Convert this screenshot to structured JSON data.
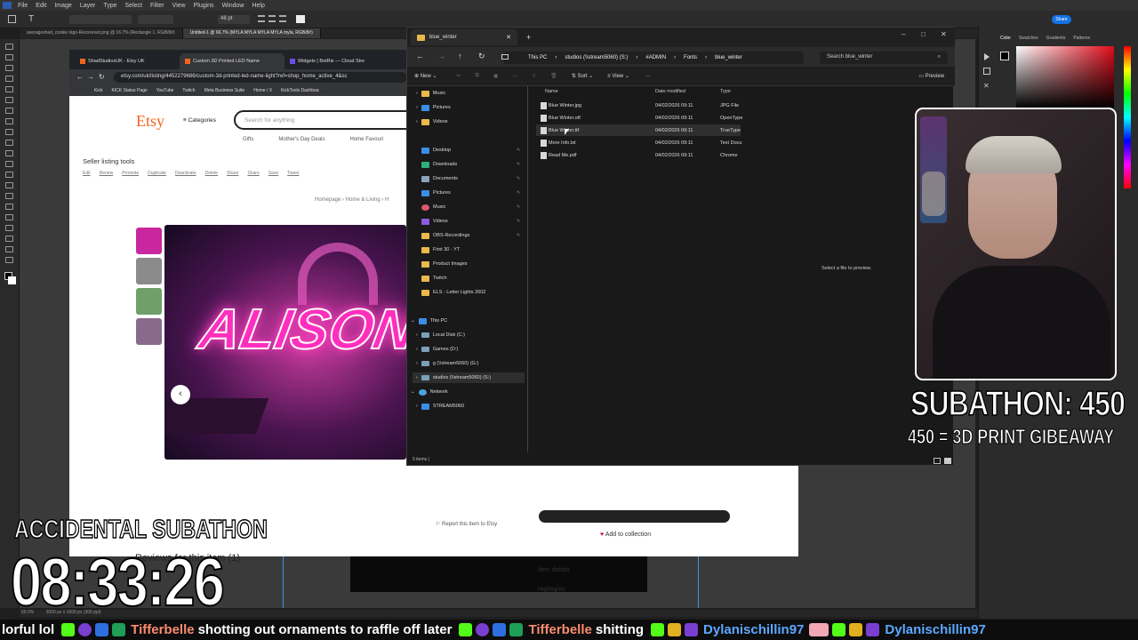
{
  "ps": {
    "menu": [
      "File",
      "Edit",
      "Image",
      "Layer",
      "Type",
      "Select",
      "Filter",
      "View",
      "Plugins",
      "Window",
      "Help"
    ],
    "doc_tabs": [
      "averageshad_cookie logo-Recovered.png @ 16.7% (Rectangle 1, RGB/8#)",
      "Untitled-1 @ 66.7% (MYLA MYLA MYLA MYLA myla, RGB/8#)"
    ],
    "font_size": "48 pt",
    "share_label": "Share",
    "right_tabs": [
      "Color",
      "Swatches",
      "Gradients",
      "Patterns"
    ],
    "status": "60.0%",
    "status2": "3000 px x 1600 px (300 ppi)"
  },
  "browser": {
    "tabs": [
      "ShadStudiosUK - Etsy UK",
      "Custom 3D Printed LED Name",
      "Widgets | BotRix — Cloud Stre"
    ],
    "url": "etsy.com/uk/listing/4452279686/custom-3d-printed-led-name-light?ref=shop_home_active_4&sc",
    "bookmarks": [
      "Kick",
      "KICK Status Page",
      "YouTube",
      "Twitch",
      "Meta Business Suite",
      "Home / X",
      "KickTools Dashboa"
    ]
  },
  "etsy": {
    "logo": "Etsy",
    "categories": "Categories",
    "search_placeholder": "Search for anything",
    "nav": [
      "Gifts",
      "Mother's Day Deals",
      "Home Favouri"
    ],
    "tools_title": "Seller listing tools",
    "tools_links": [
      "Edit",
      "Renew",
      "Promote",
      "Duplicate",
      "Deactivate",
      "Delete",
      "Share",
      "Share",
      "Save",
      "Tweet"
    ],
    "breadcrumb": "Homepage  ›  Home & Living  ›  H",
    "hero_text": "ALISON",
    "report": "Report this item to Etsy",
    "add_collection": "Add to collection",
    "reviews_title": "Reviews for this item (1)",
    "item_details": "Item details",
    "highlights": "Highlights"
  },
  "explorer": {
    "tab_title": "blue_winter",
    "breadcrumb": [
      "This PC",
      "studios (\\\\stream5060) (S:)",
      "#ADMIN",
      "Fonts",
      "blue_winter"
    ],
    "search_placeholder": "Search blue_winter",
    "cmd": {
      "new": "New",
      "sort": "Sort",
      "view": "View",
      "more": "···",
      "preview": "Preview"
    },
    "sidebar_top": [
      "Music",
      "Pictures",
      "Videos"
    ],
    "quick_access": [
      "Desktop",
      "Downloads",
      "Documents",
      "Pictures",
      "Music",
      "Videos",
      "OBS-Recordings",
      "First 30 - YT",
      "Product Images",
      "Twitch",
      "ELS - Letter Lights 2602"
    ],
    "this_pc": "This PC",
    "drives": [
      "Local Disk (C:)",
      "Games (D:)",
      "g (\\\\stream5060) (G:)",
      "studios (\\\\stream5060) (S:)"
    ],
    "network": "Network",
    "network_items": [
      "STREAM5060"
    ],
    "columns": {
      "name": "Name",
      "date": "Date modified",
      "type": "Type"
    },
    "files": [
      {
        "name": "Blue Winter.jpg",
        "date": "04/02/2026 09:11",
        "type": "JPG File"
      },
      {
        "name": "Blue Winter.otf",
        "date": "04/02/2026 09:11",
        "type": "OpenType"
      },
      {
        "name": "Blue Winter.ttf",
        "date": "04/02/2026 09:11",
        "type": "TrueType"
      },
      {
        "name": "More Info.txt",
        "date": "04/02/2026 09:11",
        "type": "Text Docu"
      },
      {
        "name": "Read Me.pdf",
        "date": "04/02/2026 09:11",
        "type": "Chrome"
      }
    ],
    "preview_hint": "Select a file to preview.",
    "status": "5 items  |"
  },
  "overlay": {
    "subathon": "SUBATHON: 450",
    "giveaway": "450 = 3D PRINT GIBEAWAY",
    "accidental": "ACCIDENTAL SUBATHON",
    "timer": "08:33:26"
  },
  "ticker": {
    "lead": "lorful lol",
    "user1": "Tifferbelle",
    "msg1": "shotting out ornaments to raffle off later",
    "user2": "Tifferbelle",
    "msg2": "shitting",
    "user3": "Dylanischillin97",
    "user4": "Dylanischillin97"
  },
  "colors": {
    "etsy": "#f1641e",
    "hero_pink": "#ff2fbe",
    "user_orange": "#fb8c6e",
    "user_blue": "#5ca8ff"
  }
}
